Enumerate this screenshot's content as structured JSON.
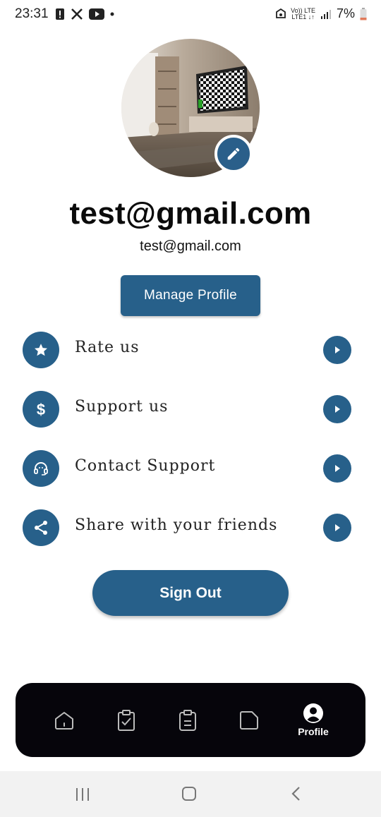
{
  "status_bar": {
    "time": "23:31",
    "net_line1": "Vo)) LTE",
    "net_line2": "LTE1 ↓↑",
    "battery": "7%",
    "icons": [
      "alert-icon",
      "x-logo-icon",
      "youtube-icon",
      "dot-icon",
      "nfc-icon",
      "signal-icon",
      "battery-icon"
    ]
  },
  "profile": {
    "display_name": "test@gmail.com",
    "email": "test@gmail.com",
    "manage_label": "Manage Profile"
  },
  "menu": {
    "items": [
      {
        "label": "Rate us",
        "icon": "star-icon"
      },
      {
        "label": "Support us",
        "icon": "dollar-icon"
      },
      {
        "label": "Contact Support",
        "icon": "headset-icon"
      },
      {
        "label": "Share with your friends",
        "icon": "share-icon"
      }
    ]
  },
  "signout_label": "Sign Out",
  "bottom_nav": {
    "items": [
      {
        "icon": "home-icon",
        "label": ""
      },
      {
        "icon": "clipboard-check-icon",
        "label": ""
      },
      {
        "icon": "clipboard-list-icon",
        "label": ""
      },
      {
        "icon": "folder-icon",
        "label": ""
      },
      {
        "icon": "profile-icon",
        "label": "Profile",
        "active": true
      }
    ]
  },
  "colors": {
    "accent": "#27608a",
    "nav_background": "#06050b",
    "background": "#ffffff"
  }
}
